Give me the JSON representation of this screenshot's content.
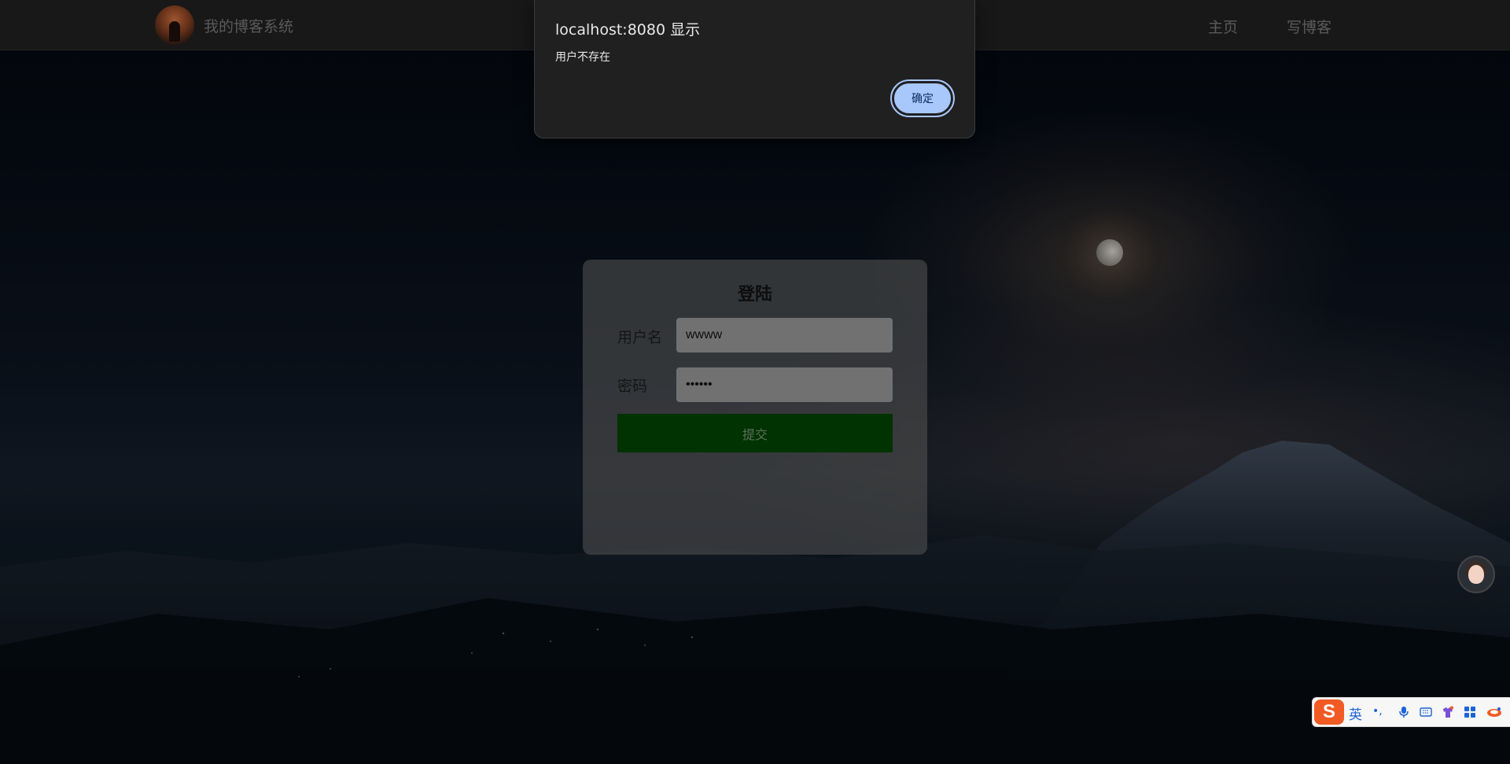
{
  "navbar": {
    "site_title": "我的博客系统",
    "links": [
      "主页",
      "写博客"
    ]
  },
  "login": {
    "heading": "登陆",
    "username_label": "用户名",
    "username_value": "wwww",
    "password_label": "密码",
    "password_value": "••••••",
    "submit_label": "提交"
  },
  "alert": {
    "title": "localhost:8080 显示",
    "message": "用户不存在",
    "ok_label": "确定"
  },
  "ime_toolbar": {
    "logo": "S",
    "mode_label": "英",
    "punct_label": "•,",
    "icons": [
      "microphone-icon",
      "keyboard-icon",
      "skin-icon",
      "apps-grid-icon",
      "extra-icon"
    ]
  },
  "colors": {
    "nav_bg": "#1e1e1e",
    "submit_bg": "#023d02",
    "dialog_bg": "#202020",
    "ok_button": "#a8c7fa",
    "ime_accent": "#1d64d6",
    "ime_logo": "#f15a22"
  }
}
